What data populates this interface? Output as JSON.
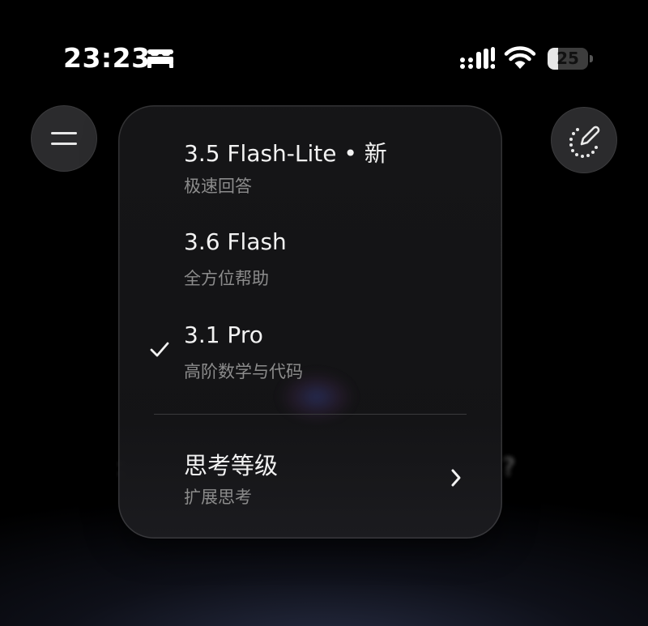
{
  "status_bar": {
    "time": "23:23",
    "sleep_icon": "bed-icon",
    "signal_icon": "cellular-signal-icon",
    "wifi_icon": "wifi-icon",
    "battery_level": "25",
    "battery_percent": 25
  },
  "header": {
    "menu_icon": "hamburger-menu-icon",
    "new_chat_icon": "new-chat-pencil-icon"
  },
  "model_menu": {
    "options": [
      {
        "title": "3.5 Flash-Lite • 新",
        "subtitle": "极速回答",
        "selected": false
      },
      {
        "title": "3.6 Flash",
        "subtitle": "全方位帮助",
        "selected": false
      },
      {
        "title": "3.1 Pro",
        "subtitle": "高阶数学与代码",
        "selected": true
      }
    ],
    "thinking": {
      "title": "思考等级",
      "subtitle": "扩展思考",
      "icon": "chevron-right-icon"
    }
  },
  "colors": {
    "background": "#000000",
    "menu_background": "#161618",
    "subtitle_text": "#8c8c8c",
    "button_background": "#2b2b2d"
  }
}
